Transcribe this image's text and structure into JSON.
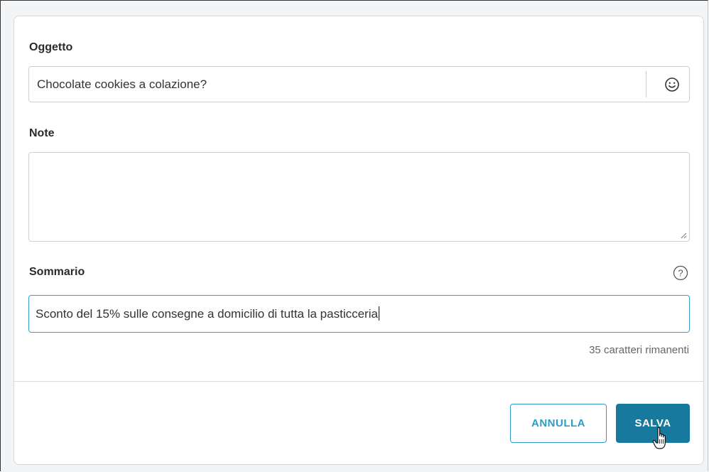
{
  "form": {
    "subject": {
      "label": "Oggetto",
      "value": "Chocolate cookies a colazione?",
      "emoji_icon": "smiley-face-icon"
    },
    "notes": {
      "label": "Note",
      "value": ""
    },
    "summary": {
      "label": "Sommario",
      "value": "Sconto del 15% sulle consegne a domicilio di tutta la pasticceria",
      "help_icon": "question-circle-icon",
      "counter": "35 caratteri rimanenti"
    }
  },
  "actions": {
    "cancel_label": "ANNULLA",
    "save_label": "SALVA"
  },
  "colors": {
    "accent": "#2f9cc4",
    "primary_button": "#17799e",
    "focus_border": "#3aa0c8"
  }
}
